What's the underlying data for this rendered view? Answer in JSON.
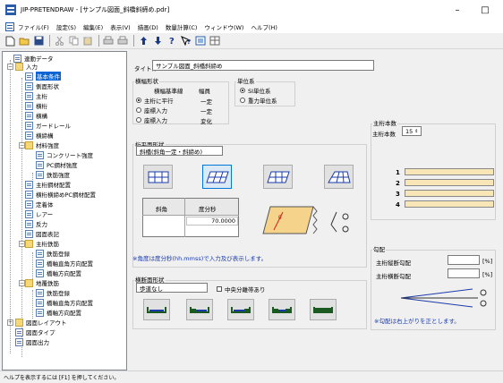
{
  "window": {
    "title": "JIP-PRETENDRAW - [サンプル図面_斜橋斜締め.pdr]",
    "minimize": "–",
    "maximize": "□"
  },
  "menu": [
    "ファイル(F)",
    "設定(S)",
    "編集(E)",
    "表示(V)",
    "描画(D)",
    "数量計算(C)",
    "ウィンドウ(W)",
    "ヘルプ(H)"
  ],
  "tree": [
    {
      "label": "連動データ",
      "icon": "doc"
    },
    {
      "label": "入力",
      "icon": "folder"
    },
    {
      "label": "基本条件",
      "icon": "doc"
    },
    {
      "label": "側面形状",
      "icon": "doc"
    },
    {
      "label": "主桁",
      "icon": "doc"
    },
    {
      "label": "横桁",
      "icon": "doc"
    },
    {
      "label": "横構",
      "icon": "doc"
    },
    {
      "label": "ガードレール",
      "icon": "doc"
    },
    {
      "label": "横締構",
      "icon": "doc"
    },
    {
      "label": "材料強度",
      "icon": "folder"
    },
    {
      "label": "コンクリート強度",
      "icon": "doc"
    },
    {
      "label": "PC鋼材強度",
      "icon": "doc"
    },
    {
      "label": "鉄筋強度",
      "icon": "doc"
    },
    {
      "label": "主桁鋼材配置",
      "icon": "doc"
    },
    {
      "label": "横桁横締めPC鋼材配置",
      "icon": "doc"
    },
    {
      "label": "定着体",
      "icon": "doc"
    },
    {
      "label": "レアー",
      "icon": "doc"
    },
    {
      "label": "反力",
      "icon": "doc"
    },
    {
      "label": "図面表記",
      "icon": "doc"
    },
    {
      "label": "主桁鉄筋",
      "icon": "folder"
    },
    {
      "label": "鉄筋登録",
      "icon": "doc"
    },
    {
      "label": "橋軸直角方向配置",
      "icon": "doc"
    },
    {
      "label": "橋軸方向配置",
      "icon": "doc"
    },
    {
      "label": "地覆鉄筋",
      "icon": "folder"
    },
    {
      "label": "鉄筋登録",
      "icon": "doc"
    },
    {
      "label": "橋軸直角方向配置",
      "icon": "doc"
    },
    {
      "label": "橋軸方向配置",
      "icon": "doc"
    },
    {
      "label": "図面レイアウト",
      "icon": "folder"
    },
    {
      "label": "図面タイプ",
      "icon": "doc"
    },
    {
      "label": "図面出力",
      "icon": "doc"
    }
  ],
  "form": {
    "title_label": "タイトル",
    "title_value": "サンプル図面_斜橋斜締め",
    "width_group": "横幅形状",
    "width_headers": [
      "横幅基準線",
      "幅員"
    ],
    "width_options": [
      {
        "label": "主桁に平行",
        "value": "一定"
      },
      {
        "label": "座標入力",
        "value": "一定"
      },
      {
        "label": "座標入力",
        "value": "変化"
      }
    ],
    "unit_group": "単位系",
    "unit_options": [
      "SI単位系",
      "重力単位系"
    ],
    "plan_group": "桁平面形状",
    "plan_type": "斜橋(斜角一定・斜締め)",
    "skew_header": [
      "斜角",
      "度分秒"
    ],
    "skew_value": "70.0000",
    "skew_note": "※角度は度分秒(hh.mmss)で入力及び表示します。",
    "main_count_group": "主桁本数",
    "main_count_label": "主桁本数",
    "main_count_value": "15",
    "main_numbers": [
      "1",
      "2",
      "3",
      "4"
    ],
    "slope_group": "勾配",
    "slope_rows": [
      {
        "label": "主桁縦断勾配",
        "unit": "[%]"
      },
      {
        "label": "主桁横断勾配",
        "unit": "[%]"
      }
    ],
    "slope_note": "※勾配は右上がりを正とします。",
    "cross_group": "横断面形状",
    "cross_type": "歩道なし",
    "median_label": "中央分離帯あり"
  },
  "status": "ヘルプを表示するには [F1] を押してください。"
}
